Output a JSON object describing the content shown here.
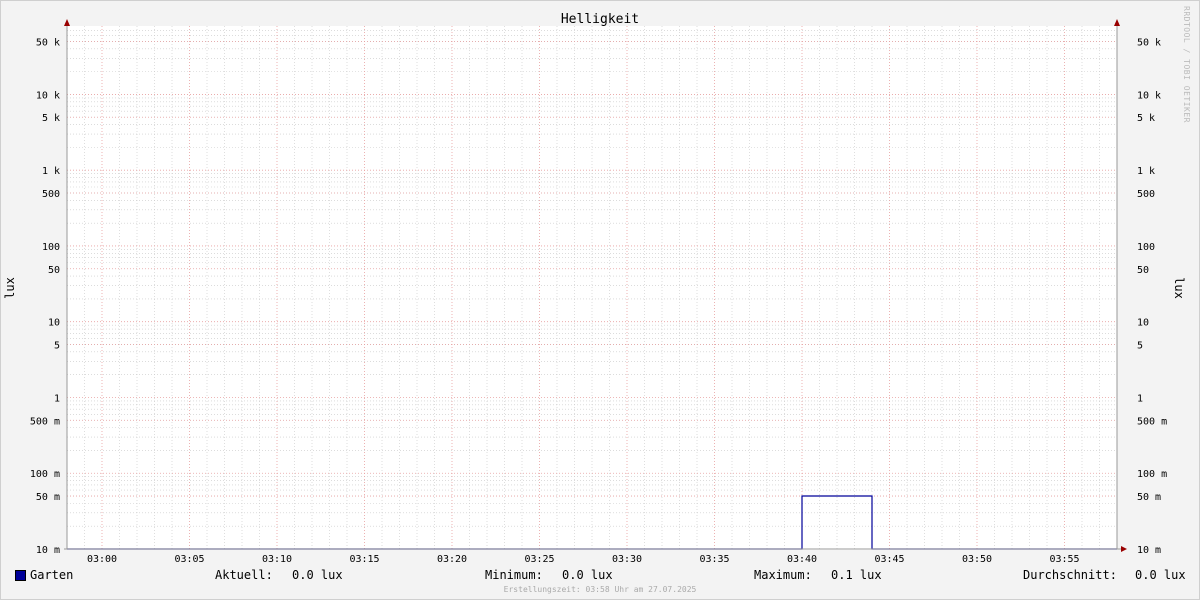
{
  "chart_data": {
    "type": "line",
    "title": "Helligkeit",
    "ylabel": "lux",
    "yscale": "log",
    "ylim": [
      0.01,
      80000
    ],
    "xlim": [
      "02:58",
      "03:58"
    ],
    "x_ticks": [
      "03:00",
      "03:05",
      "03:10",
      "03:15",
      "03:20",
      "03:25",
      "03:30",
      "03:35",
      "03:40",
      "03:45",
      "03:50",
      "03:55"
    ],
    "y_ticks": [
      {
        "value": 50000,
        "label": "50 k"
      },
      {
        "value": 10000,
        "label": "10 k"
      },
      {
        "value": 5000,
        "label": "5 k"
      },
      {
        "value": 1000,
        "label": "1 k"
      },
      {
        "value": 500,
        "label": "500"
      },
      {
        "value": 100,
        "label": "100"
      },
      {
        "value": 50,
        "label": "50"
      },
      {
        "value": 10,
        "label": "10"
      },
      {
        "value": 5,
        "label": "5"
      },
      {
        "value": 1,
        "label": "1"
      },
      {
        "value": 0.5,
        "label": "500 m"
      },
      {
        "value": 0.1,
        "label": "100 m"
      },
      {
        "value": 0.05,
        "label": "50 m"
      },
      {
        "value": 0.01,
        "label": "10 m"
      }
    ],
    "grid": true,
    "series": [
      {
        "name": "Garten",
        "color": "#000099",
        "points": [
          [
            "02:58",
            0.01
          ],
          [
            "03:40",
            0.01
          ],
          [
            "03:40",
            0.05
          ],
          [
            "03:44",
            0.05
          ],
          [
            "03:44",
            0.01
          ],
          [
            "03:58",
            0.01
          ]
        ]
      }
    ]
  },
  "legend": {
    "series_name": "Garten",
    "swatch_color": "#000099",
    "aktuell_label": "Aktuell:",
    "aktuell_value": "0.0 lux",
    "minimum_label": "Minimum:",
    "minimum_value": "0.0 lux",
    "maximum_label": "Maximum:",
    "maximum_value": "0.1 lux",
    "durchschnitt_label": "Durchschnitt:",
    "durchschnitt_value": "0.0 lux"
  },
  "watermark": "RRDTOOL / TOBI OETIKER",
  "footer": "Erstellungszeit: 03:58 Uhr am 27.07.2025",
  "colors": {
    "major_grid": "#e8a0a0",
    "minor_grid": "#c8c8c8",
    "axis": "#999999",
    "arrow": "#990000",
    "plot_bg": "#ffffff"
  }
}
